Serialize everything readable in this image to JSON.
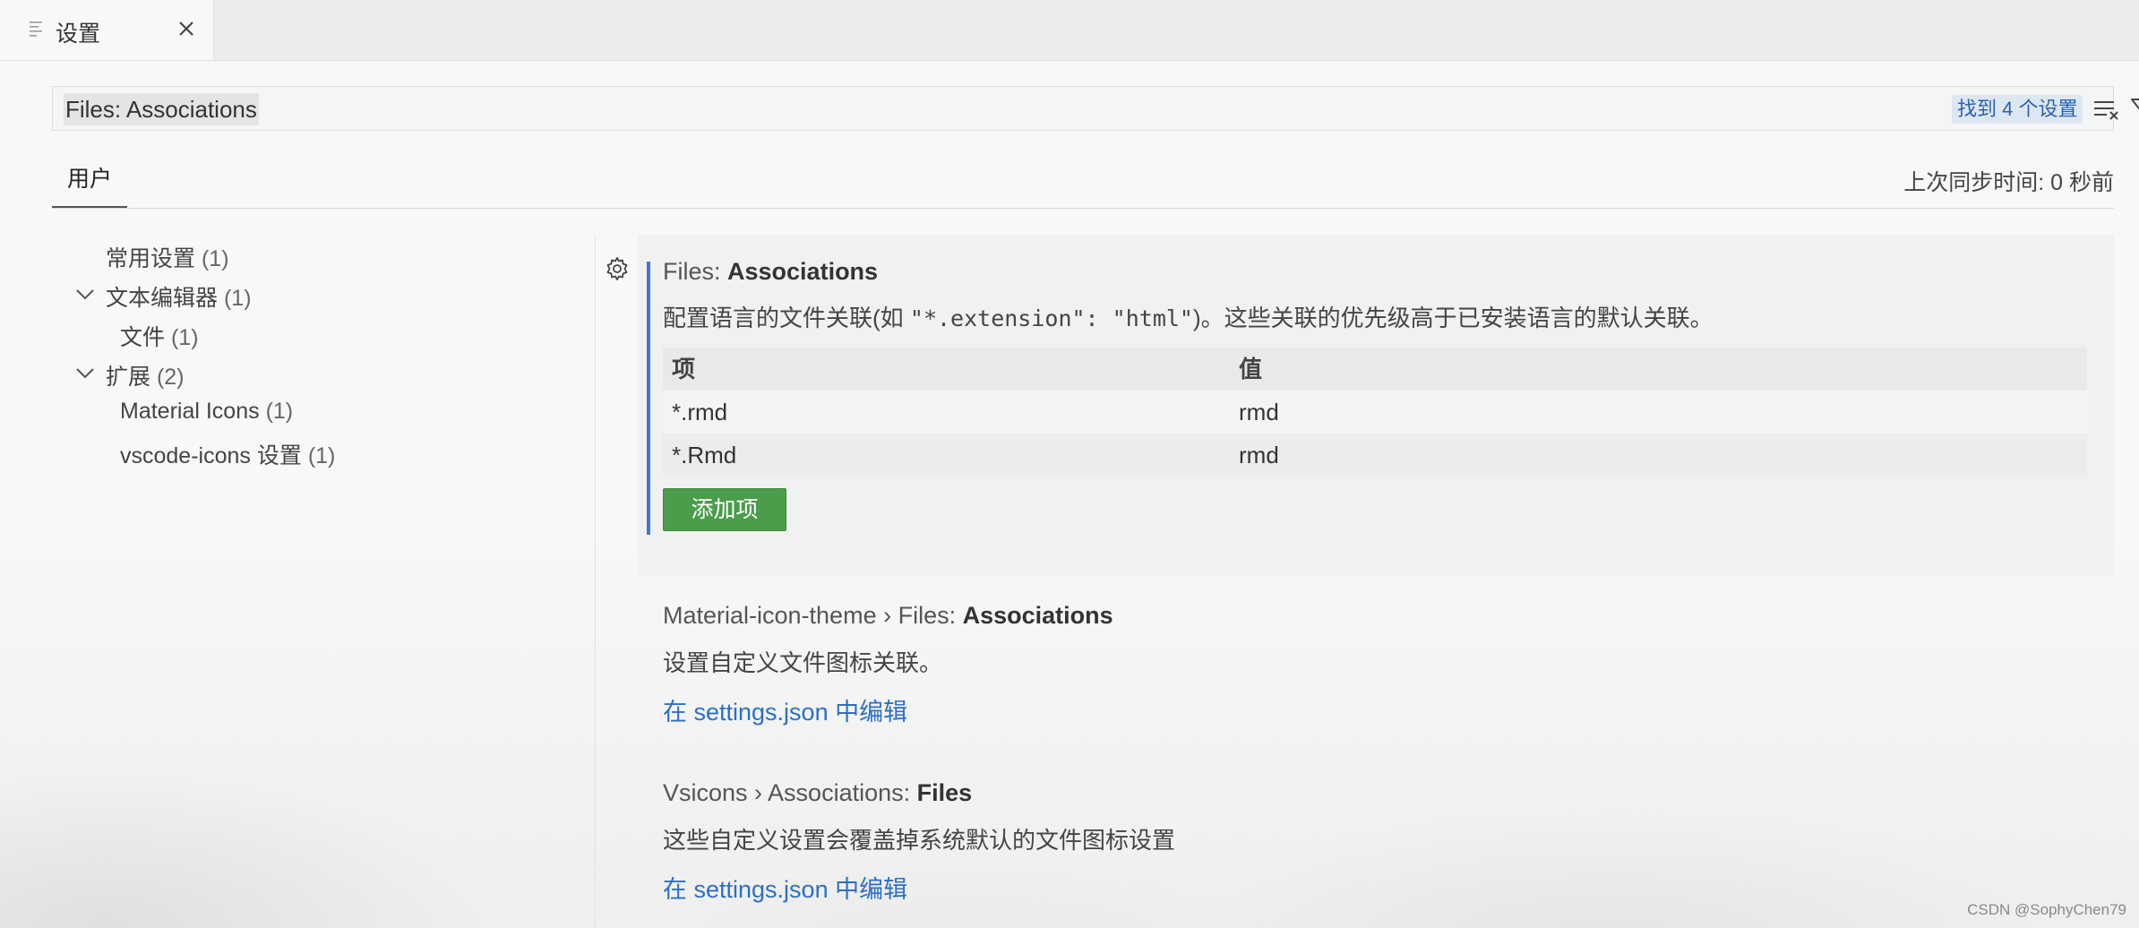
{
  "tab": {
    "title": "设置"
  },
  "search": {
    "value": "Files: Associations",
    "result_badge": "找到 4 个设置"
  },
  "scope": {
    "tab_user": "用户",
    "sync_status": "上次同步时间: 0 秒前"
  },
  "toc": {
    "common": {
      "label": "常用设置",
      "count": "(1)"
    },
    "text_editor": {
      "label": "文本编辑器",
      "count": "(1)"
    },
    "files": {
      "label": "文件",
      "count": "(1)"
    },
    "extensions": {
      "label": "扩展",
      "count": "(2)"
    },
    "material_icons": {
      "label": "Material Icons",
      "count": "(1)"
    },
    "vscode_icons": {
      "label": "vscode-icons 设置",
      "count": "(1)"
    }
  },
  "settings": {
    "files_assoc": {
      "category": "Files: ",
      "name": "Associations",
      "desc_pre": "配置语言的文件关联(如 ",
      "desc_code": "\"*.extension\": \"html\"",
      "desc_post": ")。这些关联的优先级高于已安装语言的默认关联。",
      "table": {
        "col_item": "项",
        "col_value": "值",
        "rows": [
          {
            "item": "*.rmd",
            "value": "rmd"
          },
          {
            "item": "*.Rmd",
            "value": "rmd"
          }
        ]
      },
      "add_button": "添加项"
    },
    "material": {
      "category": "Material-icon-theme › Files: ",
      "name": "Associations",
      "desc": "设置自定义文件图标关联。",
      "link": "在 settings.json 中编辑"
    },
    "vsicons": {
      "category": "Vsicons › Associations: ",
      "name": "Files",
      "desc": "这些自定义设置会覆盖掉系统默认的文件图标设置",
      "link": "在 settings.json 中编辑"
    }
  },
  "watermark": "CSDN @SophyChen79"
}
